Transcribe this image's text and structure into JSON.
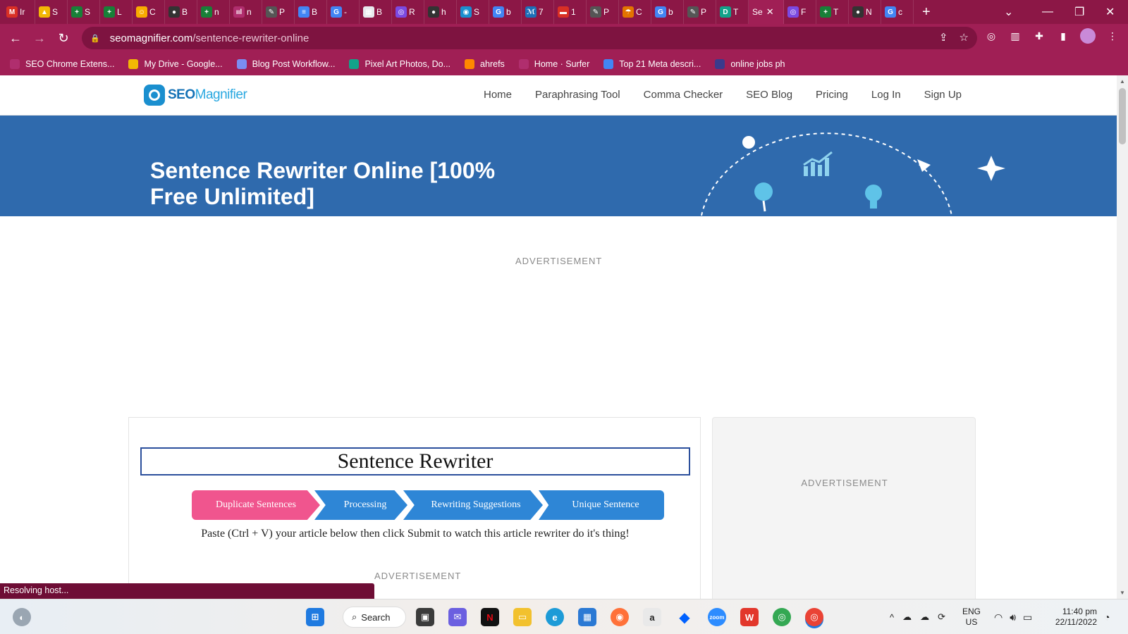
{
  "browser": {
    "tabs": [
      {
        "letter": "M",
        "title": "Ir",
        "color": "#d93025"
      },
      {
        "letter": "▲",
        "title": "S",
        "color": "#f2b705"
      },
      {
        "letter": "+",
        "title": "S",
        "color": "#188038"
      },
      {
        "letter": "+",
        "title": "L",
        "color": "#188038"
      },
      {
        "letter": "☺",
        "title": "C",
        "color": "#f9ab00"
      },
      {
        "letter": "●",
        "title": "B",
        "color": "#333333"
      },
      {
        "letter": "+",
        "title": "n",
        "color": "#188038"
      },
      {
        "letter": "ııl",
        "title": "n",
        "color": "#b02e6e"
      },
      {
        "letter": "✎",
        "title": "P",
        "color": "#555555"
      },
      {
        "letter": "≡",
        "title": "B",
        "color": "#4285f4"
      },
      {
        "letter": "G",
        "title": "-",
        "color": "#4285f4"
      },
      {
        "letter": "▦",
        "title": "B",
        "color": "#e8eaed"
      },
      {
        "letter": "◎",
        "title": "R",
        "color": "#7b4ae2"
      },
      {
        "letter": "●",
        "title": "h",
        "color": "#333333"
      },
      {
        "letter": "◉",
        "title": "S",
        "color": "#1a8fcf"
      },
      {
        "letter": "G",
        "title": "b",
        "color": "#4285f4"
      },
      {
        "letter": "ℳ",
        "title": "7",
        "color": "#1c6fb8"
      },
      {
        "letter": "▬",
        "title": "1",
        "color": "#d93025"
      },
      {
        "letter": "✎",
        "title": "P",
        "color": "#555555"
      },
      {
        "letter": "☂",
        "title": "C",
        "color": "#e37400"
      },
      {
        "letter": "G",
        "title": "b",
        "color": "#4285f4"
      },
      {
        "letter": "✎",
        "title": "P",
        "color": "#555555"
      },
      {
        "letter": "D",
        "title": "T",
        "color": "#12a38a"
      },
      {
        "letter": "",
        "title": "Se",
        "color": "#1a8fcf",
        "active": true
      },
      {
        "letter": "◎",
        "title": "F",
        "color": "#7b4ae2"
      },
      {
        "letter": "+",
        "title": "T",
        "color": "#188038"
      },
      {
        "letter": "●",
        "title": "N",
        "color": "#333333"
      },
      {
        "letter": "G",
        "title": "c",
        "color": "#4285f4"
      }
    ],
    "url_domain": "seomagnifier.com",
    "url_path": "/sentence-rewriter-online",
    "bookmarks": [
      {
        "label": "SEO Chrome Extens...",
        "color": "#b02e6e"
      },
      {
        "label": "My Drive - Google...",
        "color": "#f2b705"
      },
      {
        "label": "Blog Post Workflow...",
        "color": "#7b8cf0"
      },
      {
        "label": "Pixel Art Photos, Do...",
        "color": "#12a38a"
      },
      {
        "label": "ahrefs",
        "color": "#ff8800"
      },
      {
        "label": "Home · Surfer",
        "color": "#b02e6e"
      },
      {
        "label": "Top 21 Meta descri...",
        "color": "#4285f4"
      },
      {
        "label": "online jobs ph",
        "color": "#3a3a8c"
      }
    ]
  },
  "site": {
    "logo_seo": "SEO",
    "logo_magnifier": "Magnifier",
    "nav": [
      "Home",
      "Paraphrasing Tool",
      "Comma Checker",
      "SEO Blog",
      "Pricing",
      "Log In",
      "Sign Up"
    ],
    "hero_title": "Sentence Rewriter Online [100% Free Unlimited]",
    "ad_label": "ADVERTISEMENT",
    "tool_title": "Sentence Rewriter",
    "steps": [
      "Duplicate Sentences",
      "Processing",
      "Rewriting Suggestions",
      "Unique Sentence"
    ],
    "instructions": "Paste (Ctrl + V) your article below then click Submit to watch this article rewriter do it's thing!",
    "status": "Resolving host..."
  },
  "taskbar": {
    "search_label": "Search",
    "language": "ENG",
    "region": "US",
    "time": "11:40 pm",
    "date": "22/11/2022"
  },
  "colors": {
    "tab_strip": "#8c1746",
    "toolbar": "#a01f55",
    "hero": "#2f6aad",
    "step_active": "#f0558e",
    "step": "#2e86d6"
  }
}
